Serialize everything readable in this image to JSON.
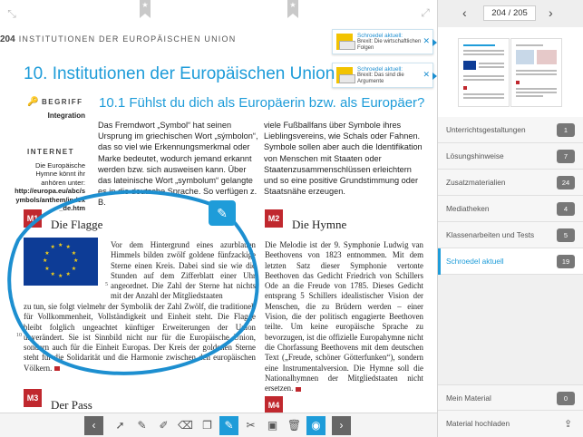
{
  "page": {
    "number": "204",
    "running_head": "INSTITUTIONEN DER EUROPÄISCHEN UNION",
    "chapter_title": "10. Institutionen der Europäischen Union",
    "subtitle": "10.1 Fühlst du dich als Europäerin bzw. als Europäer?"
  },
  "notifications": [
    {
      "title": "Schroedel aktuell:",
      "text": "Brexit: Die wirtschaftlichen Folgen"
    },
    {
      "title": "Schroedel aktuell:",
      "text": "Brexit: Das sind die Argumente"
    }
  ],
  "margin": {
    "begriff_tag": "BEGRIFF",
    "begriff_term": "Integration",
    "internet_tag": "INTERNET",
    "internet_text": "Die Europäische Hymne könnt ihr anhören unter:",
    "internet_link": "http://europa.eu/abc/symbols/anthem/index_de.htm"
  },
  "intro": {
    "col1": "Das Fremdwort „Symbol“ hat seinen Ursprung im griechischen Wort „sýmbolon“, das so viel wie Erkennungsmerkmal oder Marke bedeutet, wodurch jemand erkannt werden bzw. sich ausweisen kann. Über das lateinische Wort „symbolum“ gelangte es in die deutsche Sprache. So verfügen z. B.",
    "col2": "viele Fußballfans über Symbole ihres Lieblingsvereins, wie Schals oder Fahnen. Symbole sollen aber auch die Identifikation von Menschen mit Staaten oder Staatenzusammenschlüssen erleichtern und so eine positive Grundstimmung oder Staatsnähe erzeugen."
  },
  "materials": [
    {
      "tag": "M1",
      "heading": "Die Flagge",
      "text_a": "Vor dem Hintergrund eines azurblauen Himmels bilden zwölf goldene fünfzackige Sterne einen Kreis. Dabei sind sie wie die Stunden auf dem Zifferblatt einer Uhr angeordnet. Die Zahl der Sterne hat nichts mit der Anzahl der Mitgliedstaaten",
      "text_b": "zu tun, sie folgt vielmehr der Symbolik der Zahl Zwölf, die traditionell für Vollkommenheit, Vollständigkeit und Einheit steht. Die Flagge bleibt folglich ungeachtet künftiger Erweiterungen der Union unverändert. Sie ist Sinnbild nicht nur für die Europäische Union, sondern auch für die Einheit Europas. Der Kreis der goldenen Sterne steht für die Solidarität und die Harmonie zwischen den europäischen Völkern.",
      "line5": "5",
      "line10": "10"
    },
    {
      "tag": "M2",
      "heading": "Die Hymne",
      "text": "Die Melodie ist der 9. Symphonie Ludwig van Beethovens von 1823 entnommen. Mit dem letzten Satz dieser Symphonie vertonte Beethoven das Gedicht Friedrich von Schillers Ode an die Freude von 1785. Dieses Gedicht entsprang 5 Schillers idealistischer Vision der Menschen, die zu Brüdern werden – einer Vision, die der politisch engagierte Beethoven teilte. Um keine europäische Sprache zu bevorzugen, ist die offizielle Europahymne nicht die Chorfassung Beethovens mit dem deutschen Text („Freude, schöner Götterfunken“), sondern eine Instrumentalversion. Die Hymne soll die Nationalhymnen der Mitgliedstaaten nicht ersetzen."
    },
    {
      "tag": "M3",
      "heading": "Der Pass"
    },
    {
      "tag": "M4",
      "heading": ""
    }
  ],
  "sidebar": {
    "page_indicator": "204 / 205",
    "items": [
      {
        "label": "Unterrichtsgestaltungen",
        "count": "1"
      },
      {
        "label": "Lösungshinweise",
        "count": "7"
      },
      {
        "label": "Zusatzmaterialien",
        "count": "24"
      },
      {
        "label": "Mediatheken",
        "count": "4"
      },
      {
        "label": "Klassenarbeiten und Tests",
        "count": "5"
      },
      {
        "label": "Schroedel aktuell",
        "count": "19",
        "active": true
      }
    ],
    "my_material": {
      "label": "Mein Material",
      "count": "0"
    },
    "upload_label": "Material hochladen"
  },
  "colors": {
    "accent": "#1e9cd9",
    "material_red": "#c0282e",
    "annotation_blue": "#1d8fd0"
  },
  "toolbar_icons": [
    "chevron-left-icon",
    "pointer-icon",
    "pen-icon",
    "highlighter-icon",
    "eraser-icon",
    "copy-icon",
    "note-icon",
    "scissors-icon",
    "pages-icon",
    "trash-icon",
    "eye-icon",
    "chevron-right-icon"
  ]
}
